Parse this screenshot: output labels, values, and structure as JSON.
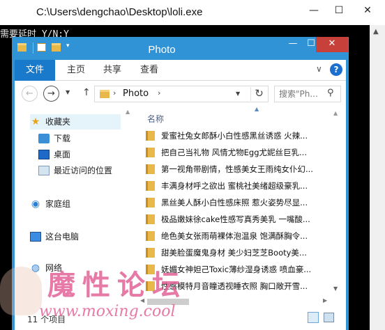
{
  "console": {
    "title": "C:\\Users\\dengchao\\Desktop\\loli.exe",
    "output": "需要延时 Y/N:Y",
    "min_glyph": "—",
    "max_glyph": "☐",
    "close_glyph": "✕"
  },
  "explorer": {
    "title": "Photo",
    "window_controls": {
      "min": "—",
      "max": "☐",
      "close": "✕"
    },
    "ribbon": {
      "tabs": [
        "文件",
        "主页",
        "共享",
        "查看"
      ],
      "expand_glyph": "∨",
      "help_glyph": "?"
    },
    "address": {
      "back": "←",
      "forward": "→",
      "up": "↑",
      "path": "Photo",
      "refresh": "↻"
    },
    "search": {
      "placeholder": "搜索\"Ph...",
      "icon": "search-icon"
    },
    "navpane": {
      "favorites": "收藏夹",
      "downloads": "下载",
      "desktop": "桌面",
      "recent": "最近访问的位置",
      "homegroup": "家庭组",
      "thispc": "这台电脑",
      "network": "网络"
    },
    "column_name": "名称",
    "files": [
      "爱蜜社兔女郎酥小白性感黑丝诱惑 火辣...",
      "把自己当礼物 风情尤物Egg尤妮丝巨乳...",
      "第一视角带剧情，性感美女王雨纯女仆幻...",
      "丰满身材呼之欲出 蜜桃社美绪超级豪乳...",
      "黑丝美人酥小白性感床照 惹火姿势尽显...",
      "极品嫩妹徐cake性感写真秀美乳 一嘴酸...",
      "绝色美女张雨萌裸体泡温泉 饱满酥胸令...",
      "甜美脸蛋魔鬼身材 美少妇芝芝Booty美...",
      "妩媚女神妲己Toxic薄纱湿身诱惑 喷血豪...",
      "性感模特月音瞳透视睡衣照 胸口敞开雪..."
    ],
    "status": "11 个项目"
  },
  "watermark": {
    "title": "魔性论坛",
    "url": "www.moxing.cool"
  },
  "colors": {
    "explorer_accent": "#2f93d6",
    "file_tab": "#1979ca",
    "close_red": "#c7413a",
    "console_bg": "#000000",
    "watermark_pink": "#e26296"
  }
}
